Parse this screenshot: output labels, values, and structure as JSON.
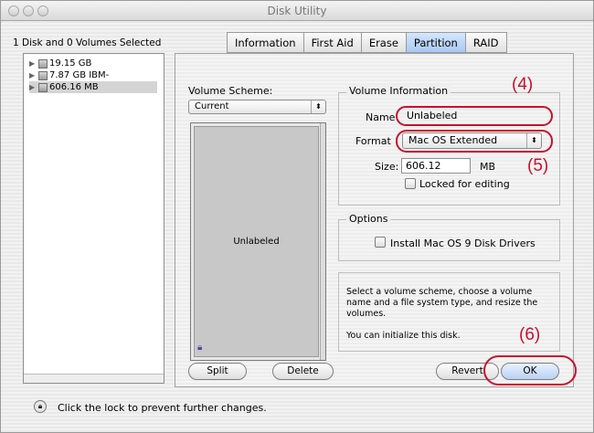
{
  "window": {
    "title": "Disk Utility"
  },
  "selection_label": "1 Disk and 0 Volumes Selected",
  "sidebar": {
    "disks": [
      {
        "label": "19.15 GB"
      },
      {
        "label": "7.87 GB IBM-"
      },
      {
        "label": "606.16 MB"
      }
    ]
  },
  "tabs": [
    {
      "label": "Information"
    },
    {
      "label": "First Aid"
    },
    {
      "label": "Erase"
    },
    {
      "label": "Partition",
      "active": true
    },
    {
      "label": "RAID"
    }
  ],
  "partition": {
    "volume_scheme_label": "Volume Scheme:",
    "volume_scheme_value": "Current",
    "map_volume_label": "Unlabeled",
    "volume_info_title": "Volume Information",
    "name_label": "Name",
    "name_value": "Unlabeled",
    "format_label": "Format",
    "format_value": "Mac OS Extended",
    "size_label": "Size:",
    "size_value": "606.12",
    "size_unit": "MB",
    "locked_label": "Locked for editing",
    "options_title": "Options",
    "install_drivers_label": "Install Mac OS 9 Disk Drivers",
    "help_text": "Select a volume scheme, choose a volume name and a file system type, and resize the volumes.",
    "status_text": "You can initialize this disk.",
    "split_label": "Split",
    "delete_label": "Delete",
    "revert_label": "Revert",
    "ok_label": "OK"
  },
  "callouts": {
    "c4": "(4)",
    "c5": "(5)",
    "c6": "(6)"
  },
  "lock_message": "Click the lock to prevent further changes.",
  "colors": {
    "annotation": "#c8102e",
    "active_tab": "#a9c9f2"
  }
}
